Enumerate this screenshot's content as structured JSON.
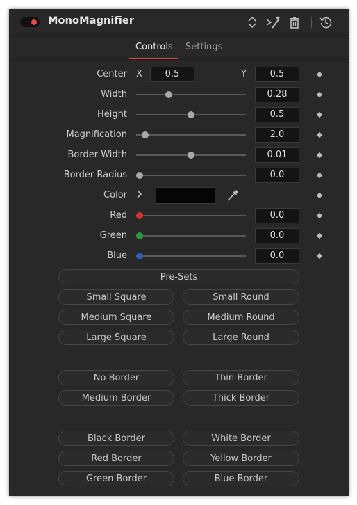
{
  "header": {
    "title": "MonoMagnifier"
  },
  "tabs": {
    "controls": "Controls",
    "settings": "Settings"
  },
  "center": {
    "label": "Center",
    "x_label": "X",
    "x_value": "0.5",
    "y_label": "Y",
    "y_value": "0.5"
  },
  "sliders": [
    {
      "label": "Width",
      "value": "0.28",
      "position": 0.28
    },
    {
      "label": "Height",
      "value": "0.5",
      "position": 0.5
    },
    {
      "label": "Magnification",
      "value": "2.0",
      "position": 0.05
    },
    {
      "label": "Border Width",
      "value": "0.01",
      "position": 0.5
    },
    {
      "label": "Border Radius",
      "value": "0.0",
      "position": 0.0
    }
  ],
  "color": {
    "label": "Color",
    "swatch": "#050505"
  },
  "channels": [
    {
      "label": "Red",
      "value": "0.0",
      "dot": "#d9302c"
    },
    {
      "label": "Green",
      "value": "0.0",
      "dot": "#2a9a3e"
    },
    {
      "label": "Blue",
      "value": "0.0",
      "dot": "#2a5fb8"
    }
  ],
  "presets": {
    "label": "Pre-Sets",
    "small_square": "Small Square",
    "small_round": "Small Round",
    "medium_square": "Medium Square",
    "medium_round": "Medium Round",
    "large_square": "Large Square",
    "large_round": "Large Round",
    "no_border": "No Border",
    "thin_border": "Thin Border",
    "medium_border": "Medium Border",
    "thick_border": "Thick Border",
    "black_border": "Black Border",
    "white_border": "White Border",
    "red_border": "Red Border",
    "yellow_border": "Yellow Border",
    "green_border": "Green Border",
    "blue_border": "Blue Border"
  },
  "icons": [
    "power-toggle-icon",
    "sort-arrows-icon",
    "magic-wand-icon",
    "trash-icon",
    "reset-history-icon",
    "chevron-right-icon",
    "eyedropper-icon",
    "keyframe-diamond-icon"
  ],
  "colors": {
    "accent": "#e0453a",
    "panel": "#282828",
    "field": "#141414"
  }
}
